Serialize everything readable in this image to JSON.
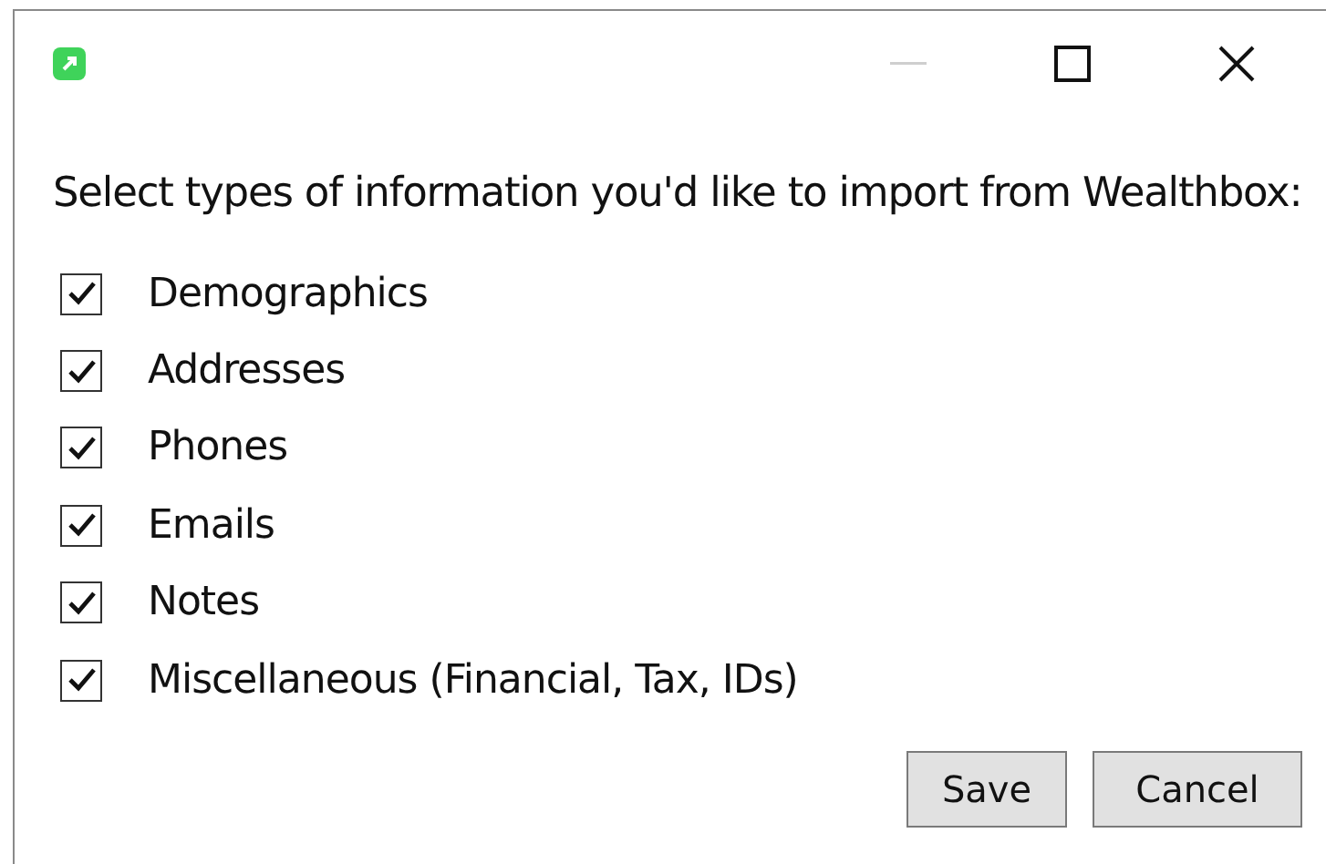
{
  "window": {
    "minimize_disabled": true
  },
  "prompt": "Select types of information you'd like to import from Wealthbox:",
  "options": [
    {
      "label": "Demographics",
      "checked": true
    },
    {
      "label": "Addresses",
      "checked": true
    },
    {
      "label": "Phones",
      "checked": true
    },
    {
      "label": "Emails",
      "checked": true
    },
    {
      "label": "Notes",
      "checked": true
    },
    {
      "label": "Miscellaneous (Financial, Tax, IDs)",
      "checked": true
    }
  ],
  "buttons": [
    "Save",
    "Cancel"
  ]
}
